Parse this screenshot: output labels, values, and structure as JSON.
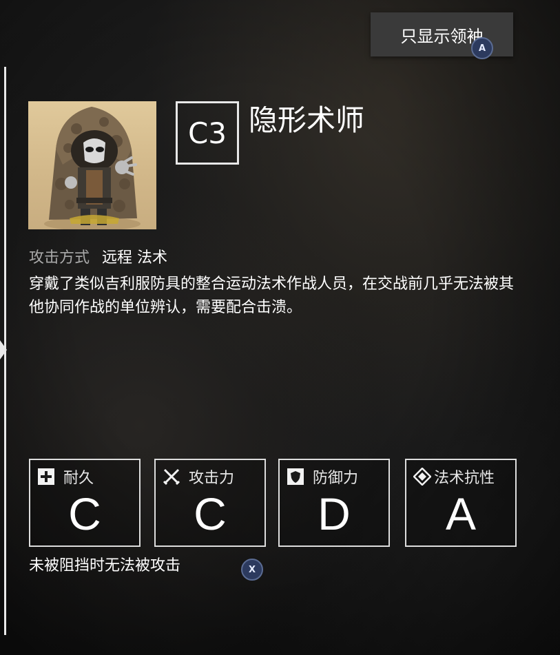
{
  "top_button": {
    "label": "只显示领袖",
    "hint_key": "A"
  },
  "enemy": {
    "level": "C3",
    "name": "隐形术师",
    "attack_label": "攻击方式",
    "attack_value": "远程 法术",
    "description": "穿戴了类似吉利服防具的整合运动法术作战人员，在交战前几乎无法被其他协同作战的单位辨认，需要配合击溃。"
  },
  "stats": [
    {
      "label": "耐久",
      "grade": "C",
      "icon": "plus-icon"
    },
    {
      "label": "攻击力",
      "grade": "C",
      "icon": "crossed-swords-icon"
    },
    {
      "label": "防御力",
      "grade": "D",
      "icon": "shield-icon"
    },
    {
      "label": "法术抗性",
      "grade": "A",
      "icon": "magic-diamond-icon"
    }
  ],
  "note": {
    "text": "未被阻挡时无法被攻击",
    "hint_key": "X"
  }
}
